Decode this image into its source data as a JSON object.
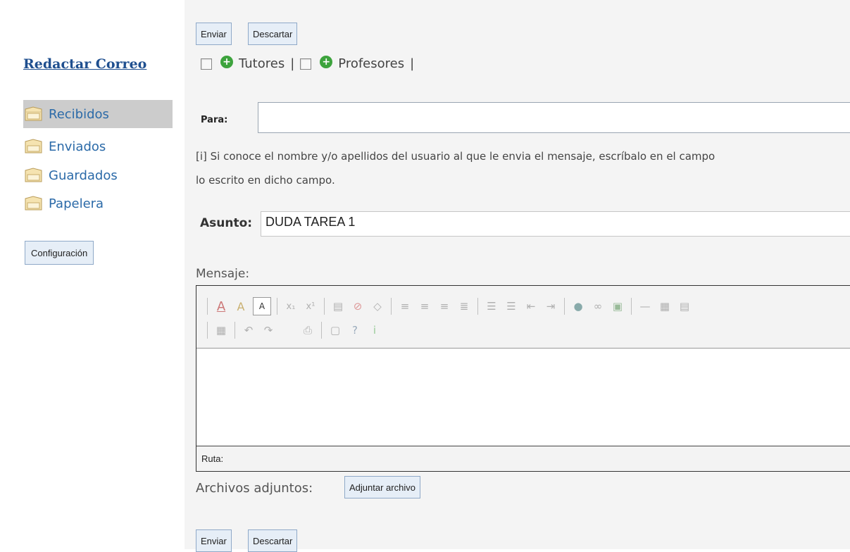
{
  "sidebar": {
    "compose_label": "Redactar Correo",
    "folders": [
      {
        "label": "Recibidos",
        "active": true
      },
      {
        "label": "Enviados",
        "active": false
      },
      {
        "label": "Guardados",
        "active": false
      },
      {
        "label": "Papelera",
        "active": false
      }
    ],
    "config_label": "Configuración"
  },
  "top_actions": {
    "send_label": "Enviar",
    "discard_label": "Descartar"
  },
  "recipients": {
    "group1_label": "Tutores",
    "group2_label": "Profesores",
    "separator": "|"
  },
  "form": {
    "para_label": "Para:",
    "para_value": "",
    "info_line1": "[i] Si conoce el nombre y/o apellidos del usuario al que le envia el mensaje, escríbalo en el campo",
    "info_line2": "lo escrito en dicho campo.",
    "asunto_label": "Asunto:",
    "asunto_value": "DUDA TAREA 1",
    "mensaje_label": "Mensaje:",
    "ruta_label": "Ruta:",
    "adjuntos_label": "Archivos adjuntos:",
    "adjuntar_label": "Adjuntar archivo"
  },
  "bottom_actions": {
    "send_label": "Enviar",
    "discard_label": "Descartar"
  },
  "colors": {
    "link": "#1f4f8f",
    "folder_text": "#2b6aa8",
    "button_bg": "#e6eef7",
    "active_bg": "#cccccc"
  }
}
